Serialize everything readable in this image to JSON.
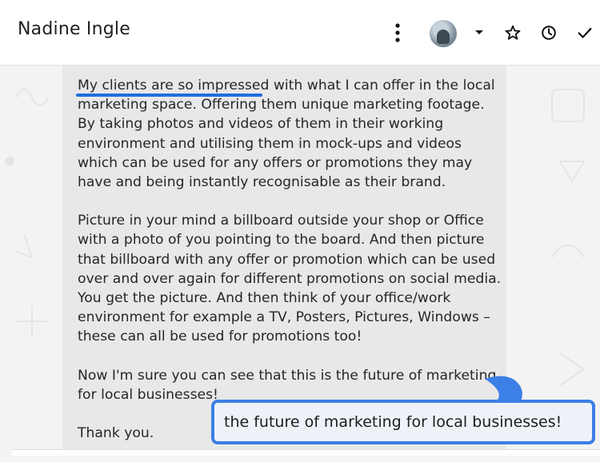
{
  "header": {
    "contact_name": "Nadine Ingle",
    "icons": [
      "more-vert-icon",
      "avatar",
      "caret-down-icon",
      "star-icon",
      "clock-icon",
      "check-icon"
    ]
  },
  "message": {
    "paragraph1_highlight": "My clients are so impressed",
    "paragraph1_rest": " with what I can offer in the local marketing space. Offering them unique marketing footage. By taking photos and videos of them in their working environment and utilising them in mock-ups and videos which can be used for any offers or promotions they may have and being instantly recognisable as their brand.",
    "paragraph2": "Picture in your mind a billboard outside your shop or Office with a photo of you pointing to the board. And then picture that billboard with any offer or promotion which can be used over and over again for different promotions on social media. You get the picture. And then think of your office/work environment for example a TV, Posters, Pictures, Windows – these can all be used for promotions too!",
    "paragraph3": "Now I'm sure you can see that this is the future of marketing for local businesses!",
    "paragraph4": "Thank you."
  },
  "callout": {
    "text": "the future of marketing for local businesses!"
  },
  "colors": {
    "accent": "#3c7fe6",
    "underline": "#1e6fe0",
    "bubble": "#e8e8e8",
    "header_bg": "#ffffff"
  }
}
